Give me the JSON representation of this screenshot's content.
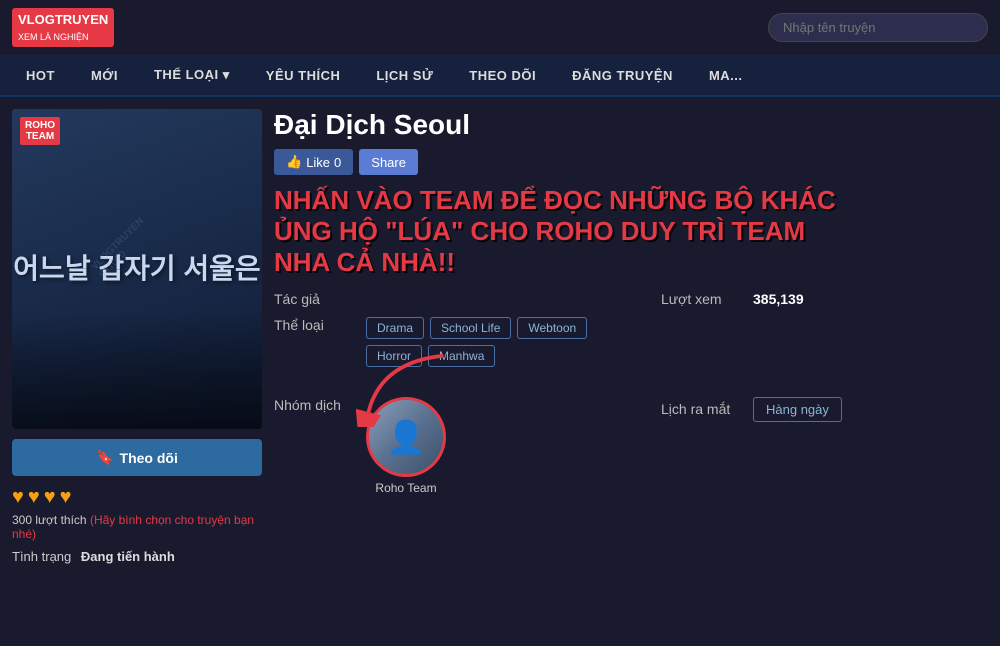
{
  "header": {
    "logo_line1": "VLOGTRUYEN",
    "logo_line2": "XEM LÀ NGHIỆN",
    "search_placeholder": "Nhập tên truyện"
  },
  "nav": {
    "items": [
      {
        "label": "HOT",
        "id": "hot"
      },
      {
        "label": "MỚI",
        "id": "moi"
      },
      {
        "label": "THỂ LOẠI ▾",
        "id": "the-loai"
      },
      {
        "label": "YÊU THÍCH",
        "id": "yeu-thich"
      },
      {
        "label": "LỊCH SỬ",
        "id": "lich-su"
      },
      {
        "label": "THEO DÕI",
        "id": "theo-doi"
      },
      {
        "label": "ĐĂNG TRUYỆN",
        "id": "dang-truyen"
      },
      {
        "label": "MA...",
        "id": "ma"
      }
    ]
  },
  "manga": {
    "title": "Đại Dịch Seoul",
    "like_count": "0",
    "like_label": "Like",
    "share_label": "Share",
    "promo_text": "NHẤN VÀO TEAM ĐỂ ĐỌC NHỮNG BỘ KHÁC ỦNG HỘ \"LÚA\" CHO ROHO DUY TRÌ TEAM NHA CẢ NHÀ!!",
    "author_label": "Tác giả",
    "author_value": "",
    "views_label": "Lượt xem",
    "views_value": "385,139",
    "genre_label": "Thể loại",
    "genres": [
      {
        "label": "Drama"
      },
      {
        "label": "School Life"
      },
      {
        "label": "Webtoon"
      },
      {
        "label": "Horror"
      },
      {
        "label": "Manhwa"
      }
    ],
    "translator_label": "Nhóm dịch",
    "translator_name": "Roho Team",
    "release_label": "Lịch ra mắt",
    "release_value": "Hàng ngày",
    "follow_label": "Theo dõi",
    "hearts": [
      "♥",
      "♥",
      "♥",
      "♥"
    ],
    "votes": "300 lượt thích",
    "vote_cta": "(Hãy bình chọn cho truyện bạn nhé)",
    "status_label": "Tình trạng",
    "status_value": "Đang tiến hành",
    "cover_korean": "어느날 갑자기 서울은",
    "cover_roho1": "ROHO",
    "cover_roho2": "TEAM",
    "watermark": "VLOGTRUYEN\n941090"
  }
}
